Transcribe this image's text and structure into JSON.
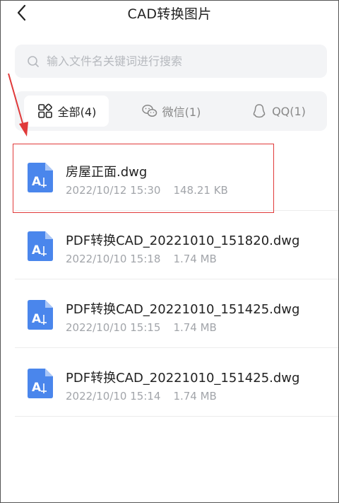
{
  "header": {
    "title": "CAD转换图片"
  },
  "search": {
    "placeholder": "输入文件名关键词进行搜索"
  },
  "tabs": [
    {
      "label": "全部(4)",
      "icon": "grid-icon",
      "active": true
    },
    {
      "label": "微信(1)",
      "icon": "wechat-icon",
      "active": false
    },
    {
      "label": "QQ(1)",
      "icon": "qq-icon",
      "active": false
    }
  ],
  "files": [
    {
      "name": "房屋正面.dwg",
      "date": "2022/10/12 15:30",
      "size": "148.21 KB",
      "highlighted": true
    },
    {
      "name": "PDF转换CAD_20221010_151820.dwg",
      "date": "2022/10/10 15:18",
      "size": "1.74 MB"
    },
    {
      "name": "PDF转换CAD_20221010_151425.dwg",
      "date": "2022/10/10 15:15",
      "size": "1.74 MB"
    },
    {
      "name": "PDF转换CAD_20221010_151425.dwg",
      "date": "2022/10/10 15:14",
      "size": "1.74 MB"
    }
  ],
  "colors": {
    "accent": "#4a86ec",
    "highlight": "#e03a3a",
    "panel": "#f3f4f6",
    "meta_text": "#a2a5aa"
  },
  "icons": {
    "back": "chevron-left-icon",
    "search": "search-icon",
    "file": "cad-file-icon",
    "annotation": "red-arrow"
  }
}
